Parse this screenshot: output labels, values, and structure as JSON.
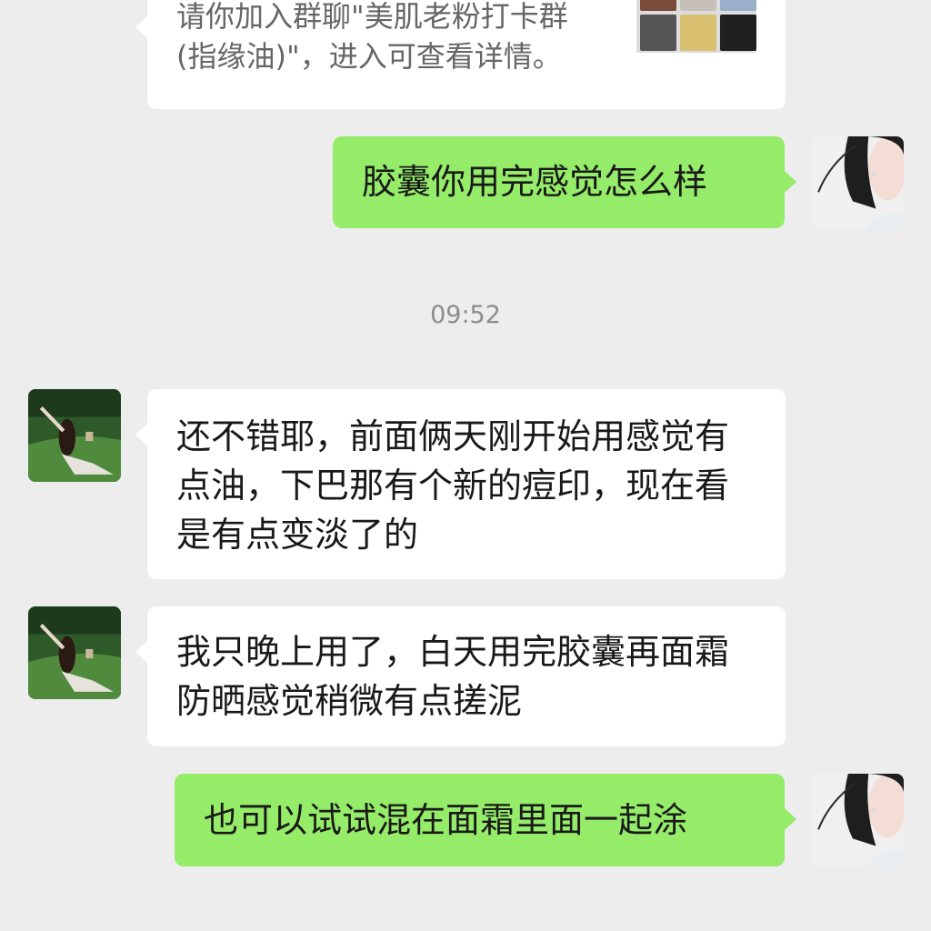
{
  "invite": {
    "line1": "请你加入群聊\"美肌老粉打卡群",
    "line2": "(指缘油)\"，进入可查看详情。"
  },
  "timestamp": "09:52",
  "messages": [
    {
      "side": "out",
      "text": "胶囊你用完感觉怎么样"
    },
    {
      "side": "in",
      "text": "还不错耶，前面俩天刚开始用感觉有点油，下巴那有个新的痘印，现在看是有点变淡了的"
    },
    {
      "side": "in",
      "text": "我只晚上用了，白天用完胶囊再面霜防晒感觉稍微有点搓泥"
    },
    {
      "side": "out",
      "text": "也可以试试混在面霜里面一起涂"
    }
  ],
  "colors": {
    "background": "#ededed",
    "incoming_bubble": "#ffffff",
    "outgoing_bubble": "#95ec69",
    "timestamp": "#8c8c8c"
  },
  "icons": {
    "self_avatar": "girl-with-earphones-avatar",
    "contact_avatar": "girl-on-grass-avatar",
    "group_thumbnail": "group-avatar-grid"
  }
}
